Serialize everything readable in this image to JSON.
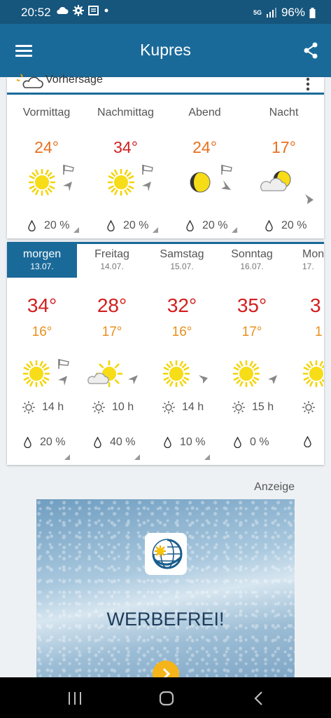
{
  "status": {
    "time": "20:52",
    "battery": "96%",
    "network": "5G"
  },
  "appbar": {
    "title": "Kupres"
  },
  "forecast_header": {
    "label": "Vorhersage"
  },
  "dayparts": [
    {
      "name": "Vormittag",
      "temp": "24°",
      "temp_color": "orange",
      "icon": "sun",
      "wind": "calm",
      "rain": "20 %"
    },
    {
      "name": "Nachmittag",
      "temp": "34°",
      "temp_color": "red",
      "icon": "sun",
      "wind": "calm",
      "rain": "20 %"
    },
    {
      "name": "Abend",
      "temp": "24°",
      "temp_color": "orange",
      "icon": "moon",
      "wind": "calm",
      "rain": "20 %"
    },
    {
      "name": "Nacht",
      "temp": "17°",
      "temp_color": "orange",
      "icon": "cloud-moon",
      "wind": "light",
      "rain": "20 %"
    }
  ],
  "days": [
    {
      "day": "morgen",
      "date": "13.07.",
      "max": "34°",
      "min": "16°",
      "icon": "sun",
      "sun": "14 h",
      "rain": "20 %",
      "selected": true
    },
    {
      "day": "Freitag",
      "date": "14.07.",
      "max": "28°",
      "min": "17°",
      "icon": "cloud-sun",
      "sun": "10 h",
      "rain": "40 %",
      "selected": false
    },
    {
      "day": "Samstag",
      "date": "15.07.",
      "max": "32°",
      "min": "16°",
      "icon": "sun",
      "sun": "14 h",
      "rain": "10 %",
      "selected": false
    },
    {
      "day": "Sonntag",
      "date": "16.07.",
      "max": "35°",
      "min": "17°",
      "icon": "sun",
      "sun": "15 h",
      "rain": "0 %",
      "selected": false
    },
    {
      "day": "Mon",
      "date": "17.",
      "max": "3",
      "min": "1",
      "icon": "sun",
      "sun": "",
      "rain": "",
      "selected": false
    }
  ],
  "ad": {
    "label": "Anzeige",
    "text": "WERBEFREI!"
  },
  "colors": {
    "appbar": "#1a6a99",
    "statusbar": "#16557c",
    "temp_red": "#d21f1f",
    "temp_orange": "#e8701e"
  }
}
